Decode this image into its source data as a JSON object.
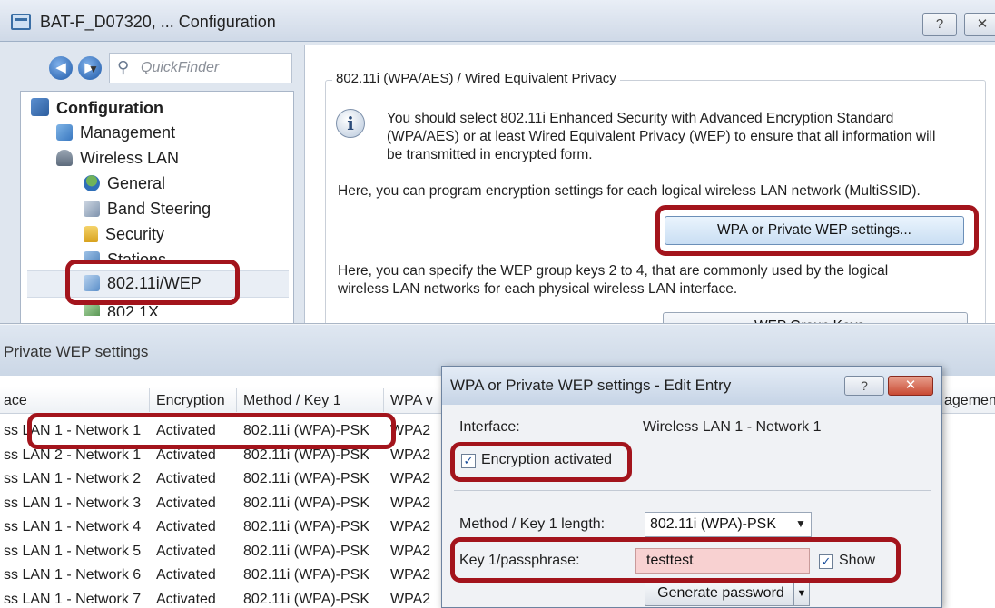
{
  "window": {
    "title": "BAT-F_D07320, ... Configuration",
    "help_button": "?",
    "close_button": "✕"
  },
  "navigation": {
    "back_icon": "back-arrow-icon",
    "forward_icon": "forward-arrow-icon",
    "quickfinder_placeholder": "QuickFinder"
  },
  "tree": {
    "root": "Configuration",
    "items": [
      {
        "label": "Management",
        "icon": "management-icon"
      },
      {
        "label": "Wireless LAN",
        "icon": "wireless-icon"
      },
      {
        "label": "General",
        "icon": "general-icon"
      },
      {
        "label": "Band Steering",
        "icon": "band-steering-icon"
      },
      {
        "label": "Security",
        "icon": "lock-icon"
      },
      {
        "label": "Stations",
        "icon": "stations-icon"
      },
      {
        "label": "802.11i/WEP",
        "icon": "wep-icon",
        "selected": true
      },
      {
        "label": "802.1X",
        "icon": "dot1x-icon"
      }
    ]
  },
  "panel": {
    "group_title": "802.11i (WPA/AES) / Wired Equivalent Privacy",
    "info_line1": "You should select 802.11i Enhanced Security with Advanced Encryption Standard",
    "info_line2": "(WPA/AES) or at least Wired Equivalent Privacy (WEP) to ensure that all information will",
    "info_line3": "be transmitted in encrypted form.",
    "program_text": "Here, you can program encryption settings for each logical wireless LAN network (MultiSSID).",
    "wpa_button": "WPA or Private WEP settings...",
    "group_keys_line1": "Here, you can specify the WEP group keys 2 to 4, that are commonly used by the logical",
    "group_keys_line2": "wireless LAN networks for each physical wireless LAN interface.",
    "group_keys_button": "WEP Group Keys..."
  },
  "list_window": {
    "title": "Private WEP settings",
    "columns": [
      "ace",
      "Encryption",
      "Method / Key 1",
      "WPA v",
      "agemen"
    ],
    "rows": [
      [
        "ss LAN 1 - Network 1",
        "Activated",
        "802.11i (WPA)-PSK",
        "WPA2"
      ],
      [
        "ss LAN 2 - Network 1",
        "Activated",
        "802.11i (WPA)-PSK",
        "WPA2"
      ],
      [
        "ss LAN 1 - Network 2",
        "Activated",
        "802.11i (WPA)-PSK",
        "WPA2"
      ],
      [
        "ss LAN 1 - Network 3",
        "Activated",
        "802.11i (WPA)-PSK",
        "WPA2"
      ],
      [
        "ss LAN 1 - Network 4",
        "Activated",
        "802.11i (WPA)-PSK",
        "WPA2"
      ],
      [
        "ss LAN 1 - Network 5",
        "Activated",
        "802.11i (WPA)-PSK",
        "WPA2"
      ],
      [
        "ss LAN 1 - Network 6",
        "Activated",
        "802.11i (WPA)-PSK",
        "WPA2"
      ],
      [
        "ss LAN 1 - Network 7",
        "Activated",
        "802.11i (WPA)-PSK",
        "WPA2"
      ]
    ]
  },
  "dialog": {
    "title": "WPA or Private WEP settings - Edit Entry",
    "help_button": "?",
    "close_button": "✕",
    "interface_label": "Interface:",
    "interface_value": "Wireless LAN 1 - Network 1",
    "encryption_label": "Encryption activated",
    "encryption_checked": true,
    "method_label": "Method / Key 1 length:",
    "method_value": "802.11i (WPA)-PSK",
    "passphrase_label": "Key 1/passphrase:",
    "passphrase_value": "testtest",
    "show_label": "Show",
    "show_checked": true,
    "generate_button": "Generate password"
  },
  "colors": {
    "highlight": "#a3141c",
    "passphrase_background": "#f8d1d1",
    "selection_background": "#e9eef5"
  }
}
